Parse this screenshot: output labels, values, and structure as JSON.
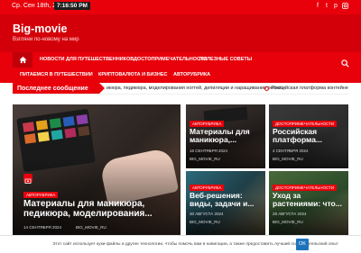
{
  "topbar": {
    "date": "Ср. Сен 18th, 2024",
    "time": "7:16:50 PM",
    "social_icons": [
      "facebook-icon",
      "twitter-icon",
      "pinterest-icon",
      "instagram-icon"
    ]
  },
  "header": {
    "site_title": "Big-movie",
    "tagline": "Взгляни по-новому на мир"
  },
  "nav": {
    "items": [
      "НОВОСТИ ДЛЯ ПУТЕШЕСТВЕННИКОВ",
      "ДОСТОПРИМЕЧАТЕЛЬНОСТИ",
      "ПОЛЕЗНЫЕ СОВЕТЫ",
      "ПИТАЕМСЯ В ПУТЕШЕСТВИИ",
      "КРИПТОВАЛЮТА И БИЗНЕС",
      "АВТОРУБРИКА"
    ]
  },
  "ticker": {
    "label": "Последнее сообщение",
    "item1": "икюра, педикюра, моделирования ногтей, депиляции и наращивания ресниц",
    "item2": "Российская платформа контейнеризации: н"
  },
  "cards": {
    "main": {
      "category": "АВТОРУБРИКА",
      "title": "Материалы для маникюра, педикюра, моделирования...",
      "date": "14 СЕНТЯБРЯ 2024",
      "author": "BIG_MOVIE_RU"
    },
    "c1": {
      "category": "АВТОРУБРИКА",
      "title": "Материалы для маникюра,...",
      "date": "16 СЕНТЯБРЯ 2024",
      "author": "BIG_MOVIE_RU"
    },
    "c2": {
      "category": "ДОСТОПРИМЕЧАТЕЛЬНОСТИ",
      "title": "Российская платформа...",
      "date": "4 СЕНТЯБРЯ 2024",
      "author": "BIG_MOVIE_RU"
    },
    "c3": {
      "category": "АВТОРУБРИКА",
      "title": "Веб-решения: виды, задачи и...",
      "date": "30 АВГУСТА 2024",
      "author": "BIG_MOVIE_RU"
    },
    "c4": {
      "category": "ДОСТОПРИМЕЧАТЕЛЬНОСТИ",
      "title": "Уход за растениями: что...",
      "date": "28 АВГУСТА 2024",
      "author": "BIG_MOVIE_RU"
    }
  },
  "cookie": {
    "message": "Этот сайт использует куки-файлы и другие технологии, чтобы помочь вам в навигации, а также предоставить лучший пользовательский опыт",
    "ok_label": "OK"
  },
  "colors": {
    "brand_red": "#e8000b",
    "header_red": "#d40009",
    "ok_blue": "#1e73be"
  }
}
